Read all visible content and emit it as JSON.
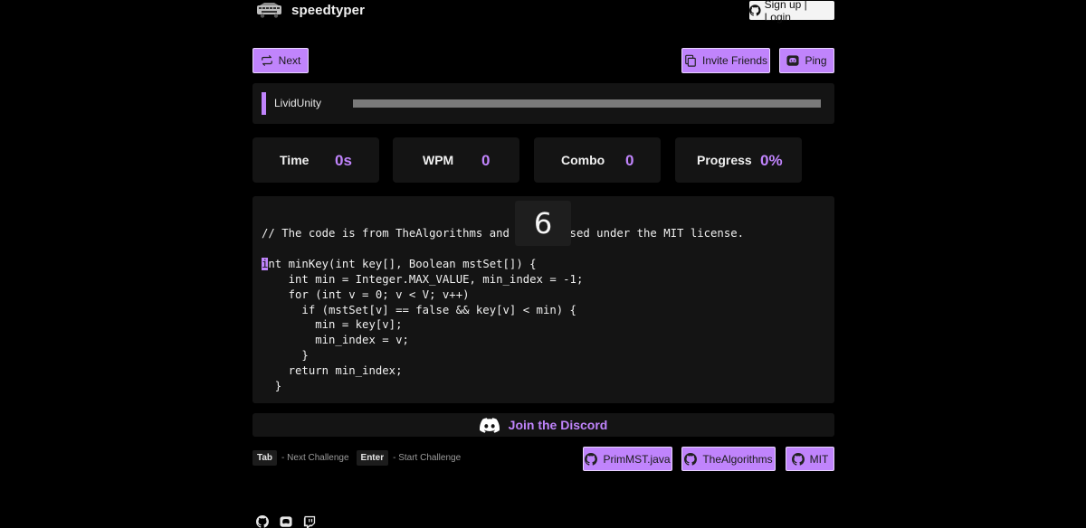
{
  "header": {
    "brand": "speedtyper",
    "logo_icon": "keyboard-car-icon",
    "auth_label": "Sign up | Login"
  },
  "toolbar": {
    "next_label": "Next",
    "invite_label": "Invite Friends",
    "ping_label": "Ping"
  },
  "racer": {
    "name": "LividUnity",
    "progress_fraction": 0
  },
  "stats": {
    "time_label": "Time",
    "time_value": "0s",
    "wpm_label": "WPM",
    "wpm_value": "0",
    "combo_label": "Combo",
    "combo_value": "0",
    "progress_label": "Progress",
    "progress_value": "0%"
  },
  "countdown": "6",
  "code": {
    "lines": [
      "// The code is from TheAlgorithms and is licensed under the MIT license.",
      "",
      "int minKey(int key[], Boolean mstSet[]) {",
      "    int min = Integer.MAX_VALUE, min_index = -1;",
      "    for (int v = 0; v < V; v++)",
      "      if (mstSet[v] == false && key[v] < min) {",
      "        min = key[v];",
      "        min_index = v;",
      "      }",
      "    return min_index;",
      "  }"
    ],
    "cursor_line": 2,
    "cursor_col": 0
  },
  "discord": {
    "label": "Join the Discord"
  },
  "hints": {
    "tab_key": "Tab",
    "tab_text": "- Next Challenge",
    "enter_key": "Enter",
    "enter_text": "- Start Challenge"
  },
  "source": {
    "file_label": "PrimMST.java",
    "repo_label": "TheAlgorithms",
    "license_label": "MIT"
  },
  "colors": {
    "accent": "#c084fc",
    "background": "#000000",
    "panel": "#141414"
  }
}
